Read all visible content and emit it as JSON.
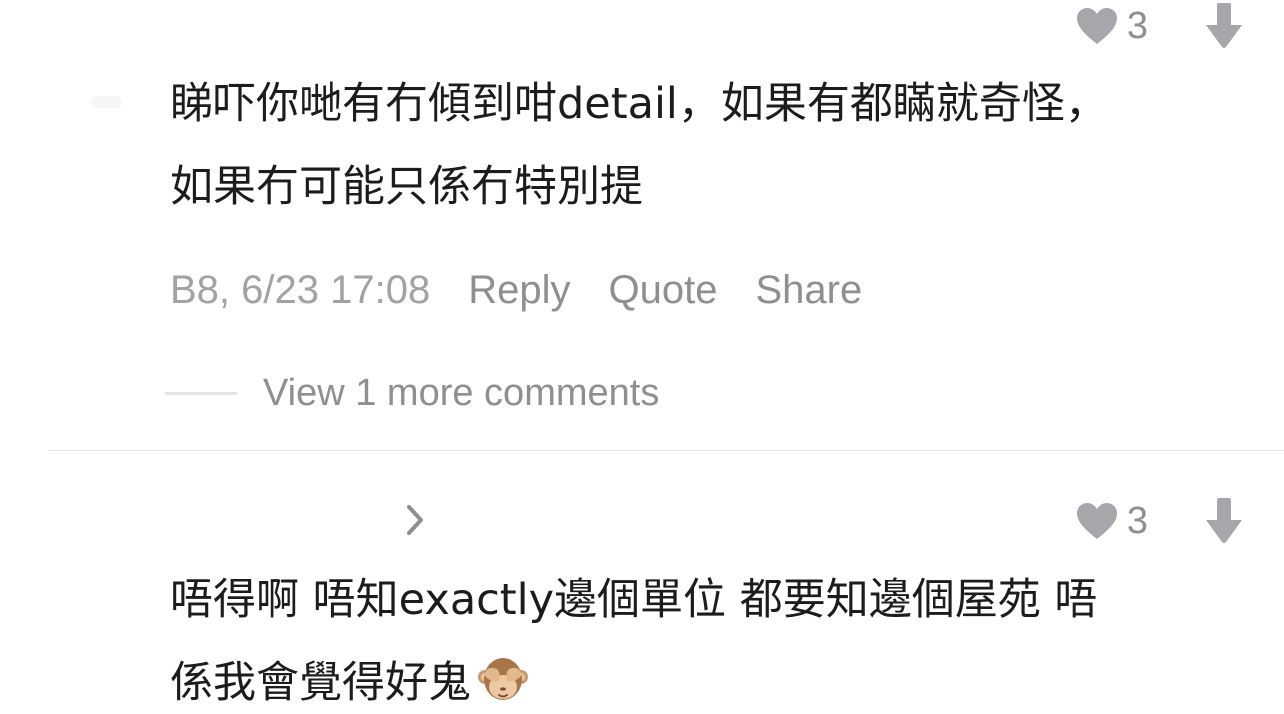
{
  "comments": [
    {
      "likes": "3",
      "body_line1": "睇吓你哋有冇傾到咁detail，如果有都瞞就奇怪，",
      "body_line2": "如果冇可能只係冇特別提",
      "timestamp": "B8, 6/23 17:08",
      "reply_label": "Reply",
      "quote_label": "Quote",
      "share_label": "Share",
      "view_more": "View 1 more comments",
      "icons": {
        "like": "heart-icon",
        "downvote": "arrow-down-icon"
      }
    },
    {
      "likes": "3",
      "body_line1": "唔得啊 唔知exactly邊個單位 都要知邊個屋苑 唔",
      "body_line2": "係我會覺得好鬼",
      "emoji": "see-no-evil-monkey",
      "icons": {
        "like": "heart-icon",
        "downvote": "arrow-down-icon",
        "expand": "chevron-right-icon"
      }
    }
  ],
  "colors": {
    "text": "#1c1c1e",
    "muted": "#8e8e93",
    "timestamp": "#a1a1a6",
    "icon": "#a7a7ab",
    "divider": "#e6e6e8"
  }
}
